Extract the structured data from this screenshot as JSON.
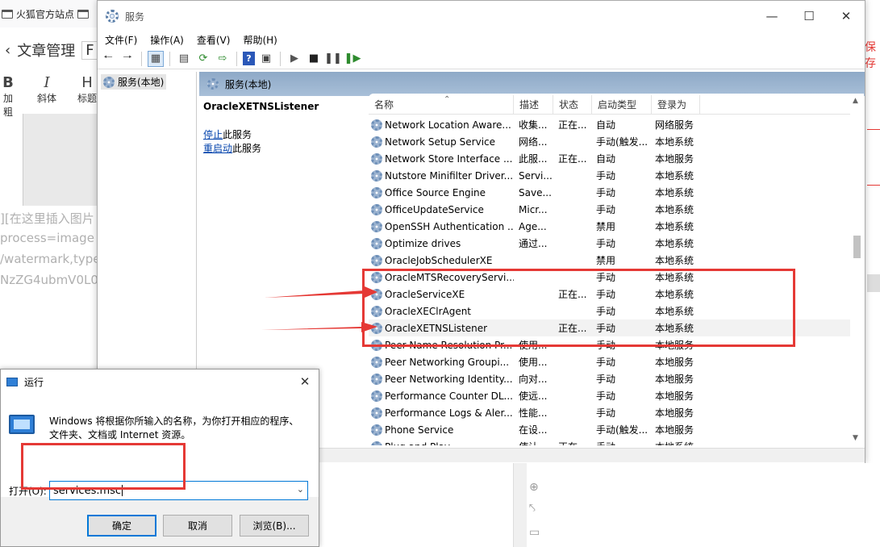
{
  "browser": {
    "bookmark_label": "火狐官方站点"
  },
  "editor": {
    "header_title": "文章管理",
    "header_input_partial": "F",
    "tools": [
      {
        "glyph": "B",
        "label": "加粗"
      },
      {
        "glyph": "I",
        "label": "斜体"
      },
      {
        "glyph": "H",
        "label": "标题"
      }
    ],
    "md_lines": [
      "][在这里插入图片",
      "process=image",
      "/watermark,type_",
      "NzZG4ubmV0L0"
    ],
    "save_partial": "保存"
  },
  "services": {
    "window_title": "服务",
    "window_controls": [
      "—",
      "☐",
      "✕"
    ],
    "menu": [
      "文件(F)",
      "操作(A)",
      "查看(V)",
      "帮助(H)"
    ],
    "tree_item": "服务(本地)",
    "pane_title": "服务(本地)",
    "detail_title": "OracleXETNSListener",
    "stop_link": "停止",
    "stop_suffix": "此服务",
    "restart_link": "重启动",
    "restart_suffix": "此服务",
    "columns": [
      "名称",
      "描述",
      "状态",
      "启动类型",
      "登录为"
    ],
    "rows": [
      [
        "Network Location Aware...",
        "收集...",
        "正在...",
        "自动",
        "网络服务"
      ],
      [
        "Network Setup Service",
        "网络...",
        "",
        "手动(触发...",
        "本地系统"
      ],
      [
        "Network Store Interface ...",
        "此服...",
        "正在...",
        "自动",
        "本地服务"
      ],
      [
        "Nutstore Minifilter Driver...",
        "Servi...",
        "",
        "手动",
        "本地系统"
      ],
      [
        "Office  Source Engine",
        "Save...",
        "",
        "手动",
        "本地系统"
      ],
      [
        "OfficeUpdateService",
        "Micr...",
        "",
        "手动",
        "本地系统"
      ],
      [
        "OpenSSH Authentication ...",
        "Age...",
        "",
        "禁用",
        "本地系统"
      ],
      [
        "Optimize drives",
        "通过...",
        "",
        "手动",
        "本地系统"
      ],
      [
        "OracleJobSchedulerXE",
        "",
        "",
        "禁用",
        "本地系统"
      ],
      [
        "OracleMTSRecoveryServi...",
        "",
        "",
        "手动",
        "本地系统"
      ],
      [
        "OracleServiceXE",
        "",
        "正在...",
        "手动",
        "本地系统"
      ],
      [
        "OracleXEClrAgent",
        "",
        "",
        "手动",
        "本地系统"
      ],
      [
        "OracleXETNSListener",
        "",
        "正在...",
        "手动",
        "本地系统"
      ],
      [
        "Peer Name Resolution Pr...",
        "使用...",
        "",
        "手动",
        "本地服务"
      ],
      [
        "Peer Networking Groupi...",
        "使用...",
        "",
        "手动",
        "本地服务"
      ],
      [
        "Peer Networking Identity...",
        "向对...",
        "",
        "手动",
        "本地服务"
      ],
      [
        "Performance Counter DL...",
        "使远...",
        "",
        "手动",
        "本地服务"
      ],
      [
        "Performance Logs & Aler...",
        "性能...",
        "",
        "手动",
        "本地服务"
      ],
      [
        "Phone Service",
        "在设...",
        "",
        "手动(触发...",
        "本地服务"
      ],
      [
        "Plug and Play",
        "使计...",
        "正在...",
        "手动",
        "本地系统"
      ]
    ],
    "selected_row": 12
  },
  "run_dialog": {
    "title": "运行",
    "close": "✕",
    "description": "Windows 将根据你所输入的名称，为你打开相应的程序、文件夹、文档或 Internet 资源。",
    "open_label": "打开(O):",
    "input_value": "services.msc",
    "ok": "确定",
    "cancel": "取消",
    "browse": "浏览(B)..."
  },
  "colors": {
    "annotation_red": "#e53935",
    "link_blue": "#0645ad",
    "pane_header": "#a8bfd8"
  },
  "icons": [
    "folder-icon",
    "chevron-left-icon",
    "gear-icon",
    "service-gear-icon",
    "run-app-icon",
    "sort-up-icon",
    "dropdown-arrow-icon"
  ]
}
